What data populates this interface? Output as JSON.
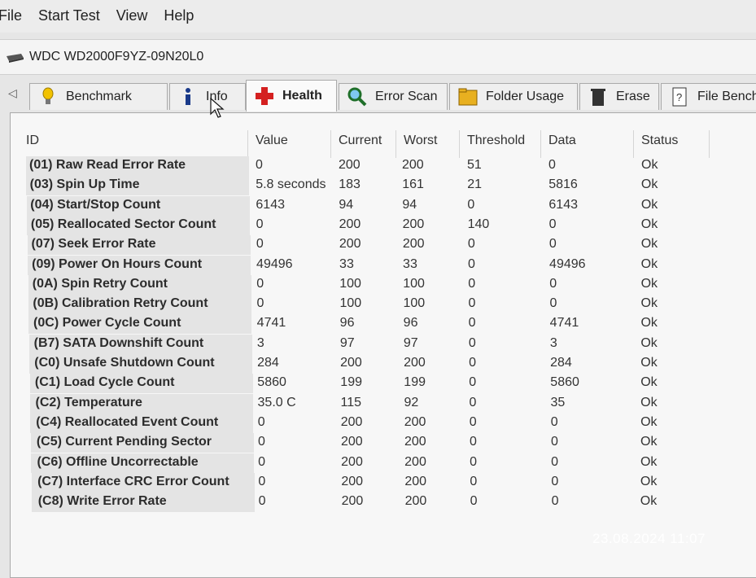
{
  "menu": [
    "File",
    "Start Test",
    "View",
    "Help"
  ],
  "drive": {
    "name": "WDC WD2000F9YZ-09N20L0"
  },
  "tabs": [
    {
      "label": "Benchmark",
      "icon": "lightbulb-icon",
      "active": false
    },
    {
      "label": "Info",
      "icon": "info-icon",
      "active": false
    },
    {
      "label": "Health",
      "icon": "red-cross-icon",
      "active": true
    },
    {
      "label": "Error Scan",
      "icon": "magnifier-icon",
      "active": false
    },
    {
      "label": "Folder Usage",
      "icon": "folder-icon",
      "active": false
    },
    {
      "label": "Erase",
      "icon": "trash-icon",
      "active": false
    },
    {
      "label": "File Bench",
      "icon": "file-bench-icon",
      "active": false
    }
  ],
  "table": {
    "headers": {
      "id": "ID",
      "value": "Value",
      "current": "Current",
      "worst": "Worst",
      "threshold": "Threshold",
      "data": "Data",
      "status": "Status"
    },
    "rows": [
      {
        "id": "(01) Raw Read Error Rate",
        "value": "0",
        "current": "200",
        "worst": "200",
        "threshold": "51",
        "data": "0",
        "status": "Ok"
      },
      {
        "id": "(03) Spin Up Time",
        "value": "5.8 seconds",
        "current": "183",
        "worst": "161",
        "threshold": "21",
        "data": "5816",
        "status": "Ok"
      },
      {
        "id": "(04) Start/Stop Count",
        "value": "6143",
        "current": "94",
        "worst": "94",
        "threshold": "0",
        "data": "6143",
        "status": "Ok"
      },
      {
        "id": "(05) Reallocated Sector Count",
        "value": "0",
        "current": "200",
        "worst": "200",
        "threshold": "140",
        "data": "0",
        "status": "Ok"
      },
      {
        "id": "(07) Seek Error Rate",
        "value": "0",
        "current": "200",
        "worst": "200",
        "threshold": "0",
        "data": "0",
        "status": "Ok"
      },
      {
        "id": "(09) Power On Hours Count",
        "value": "49496",
        "current": "33",
        "worst": "33",
        "threshold": "0",
        "data": "49496",
        "status": "Ok"
      },
      {
        "id": "(0A) Spin Retry Count",
        "value": "0",
        "current": "100",
        "worst": "100",
        "threshold": "0",
        "data": "0",
        "status": "Ok"
      },
      {
        "id": "(0B) Calibration Retry Count",
        "value": "0",
        "current": "100",
        "worst": "100",
        "threshold": "0",
        "data": "0",
        "status": "Ok"
      },
      {
        "id": "(0C) Power Cycle Count",
        "value": "4741",
        "current": "96",
        "worst": "96",
        "threshold": "0",
        "data": "4741",
        "status": "Ok"
      },
      {
        "id": "(B7) SATA Downshift Count",
        "value": "3",
        "current": "97",
        "worst": "97",
        "threshold": "0",
        "data": "3",
        "status": "Ok"
      },
      {
        "id": "(C0) Unsafe Shutdown Count",
        "value": "284",
        "current": "200",
        "worst": "200",
        "threshold": "0",
        "data": "284",
        "status": "Ok"
      },
      {
        "id": "(C1) Load Cycle Count",
        "value": "5860",
        "current": "199",
        "worst": "199",
        "threshold": "0",
        "data": "5860",
        "status": "Ok"
      },
      {
        "id": "(C2) Temperature",
        "value": "35.0 C",
        "current": "115",
        "worst": "92",
        "threshold": "0",
        "data": "35",
        "status": "Ok"
      },
      {
        "id": "(C4) Reallocated Event Count",
        "value": "0",
        "current": "200",
        "worst": "200",
        "threshold": "0",
        "data": "0",
        "status": "Ok"
      },
      {
        "id": "(C5) Current Pending Sector",
        "value": "0",
        "current": "200",
        "worst": "200",
        "threshold": "0",
        "data": "0",
        "status": "Ok"
      },
      {
        "id": "(C6) Offline Uncorrectable",
        "value": "0",
        "current": "200",
        "worst": "200",
        "threshold": "0",
        "data": "0",
        "status": "Ok"
      },
      {
        "id": "(C7) Interface CRC Error Count",
        "value": "0",
        "current": "200",
        "worst": "200",
        "threshold": "0",
        "data": "0",
        "status": "Ok"
      },
      {
        "id": "(C8) Write Error Rate",
        "value": "0",
        "current": "200",
        "worst": "200",
        "threshold": "0",
        "data": "0",
        "status": "Ok"
      }
    ]
  },
  "overlay": {
    "timestamp": "23.08.2024  11:07"
  },
  "colors": {
    "accent_red": "#d42020",
    "id_column_bg": "#e4e4e4",
    "window_bg": "#f7f7f7"
  }
}
